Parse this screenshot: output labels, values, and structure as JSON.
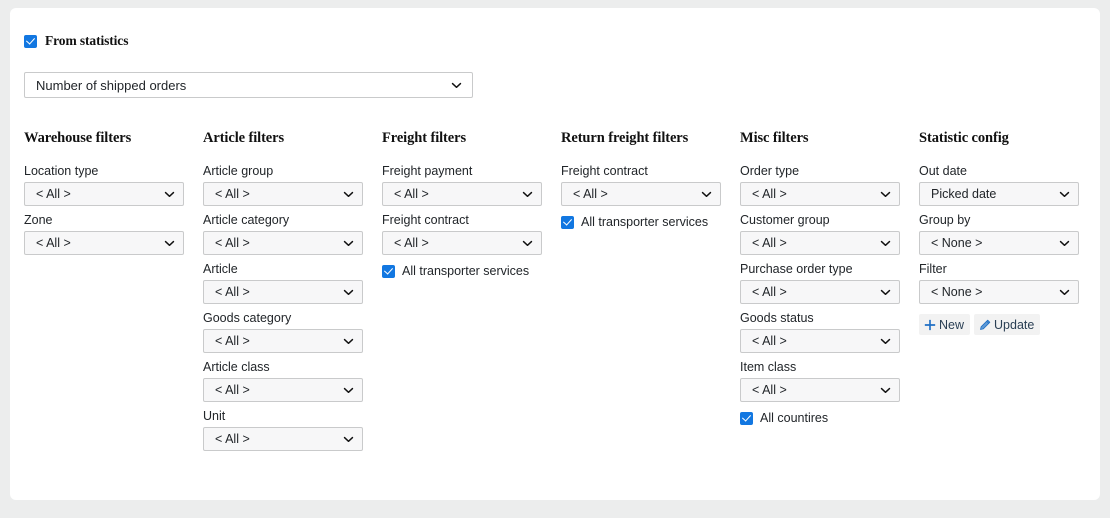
{
  "top": {
    "from_statistics_label": "From statistics",
    "from_statistics_checked": true,
    "statistic_select_value": "Number of shipped orders"
  },
  "colors": {
    "accent_blue": "#1277e1",
    "icon_blue": "#1f6fc4",
    "page_bg": "#eceded",
    "card_bg": "#ffffff",
    "field_bg": "#f7f7f8",
    "border": "#c9cacb",
    "text": "#212529"
  },
  "columns": [
    {
      "title": "Warehouse filters",
      "fields": [
        {
          "label": "Location type",
          "value": "< All >"
        },
        {
          "label": "Zone",
          "value": "< All >"
        }
      ],
      "checkbox": null
    },
    {
      "title": "Article filters",
      "fields": [
        {
          "label": "Article group",
          "value": "< All >"
        },
        {
          "label": "Article category",
          "value": "< All >"
        },
        {
          "label": "Article",
          "value": "< All >"
        },
        {
          "label": "Goods category",
          "value": "< All >"
        },
        {
          "label": "Article class",
          "value": "< All >"
        },
        {
          "label": "Unit",
          "value": "< All >"
        }
      ],
      "checkbox": null
    },
    {
      "title": "Freight filters",
      "fields": [
        {
          "label": "Freight payment",
          "value": "< All >"
        },
        {
          "label": "Freight contract",
          "value": "< All >"
        }
      ],
      "checkbox": {
        "label": "All transporter services",
        "checked": true
      }
    },
    {
      "title": "Return freight filters",
      "fields": [
        {
          "label": "Freight contract",
          "value": "< All >"
        }
      ],
      "checkbox": {
        "label": "All transporter services",
        "checked": true
      }
    },
    {
      "title": "Misc filters",
      "fields": [
        {
          "label": "Order type",
          "value": "< All >"
        },
        {
          "label": "Customer group",
          "value": "< All >"
        },
        {
          "label": "Purchase order type",
          "value": "< All >"
        },
        {
          "label": "Goods status",
          "value": "< All >"
        },
        {
          "label": "Item class",
          "value": "< All >"
        }
      ],
      "checkbox": {
        "label": "All countires",
        "checked": true
      }
    },
    {
      "title": "Statistic config",
      "fields": [
        {
          "label": "Out date",
          "value": "Picked date"
        },
        {
          "label": "Group by",
          "value": "< None >"
        },
        {
          "label": "Filter",
          "value": "< None >"
        }
      ],
      "checkbox": null,
      "buttons": [
        {
          "name": "new",
          "glyph": "+",
          "label": "New"
        },
        {
          "name": "update",
          "glyph": "pencil",
          "label": "Update"
        }
      ]
    }
  ]
}
